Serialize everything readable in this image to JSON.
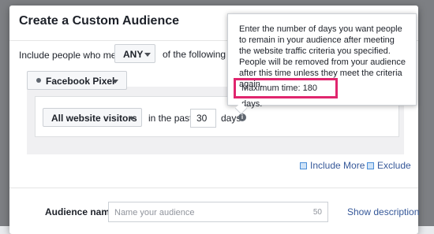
{
  "modal": {
    "title": "Create a Custom Audience"
  },
  "rule": {
    "prefix": "Include people who meet",
    "match_value": "ANY",
    "suffix": "of the following crite"
  },
  "pixel": {
    "label": "Facebook Pixel"
  },
  "criteria": {
    "visitors_label": "All website visitors",
    "in_past": "in the past",
    "days_value": "30",
    "days_label": "days",
    "info_glyph": "i"
  },
  "actions": {
    "include_more": "Include More",
    "exclude": "Exclude"
  },
  "audience": {
    "label": "Audience name",
    "placeholder": "Name your audience",
    "char_count": "50",
    "show_description": "Show description"
  },
  "tooltip": {
    "text": "Enter the number of days you want people to remain in your audience after meeting the website traffic criteria you specified. People will be removed from your audience after this time unless they meet the criteria again.",
    "max_time": "Maximum time: 180 days."
  },
  "colors": {
    "link": "#365899",
    "highlight": "#e0266e"
  }
}
